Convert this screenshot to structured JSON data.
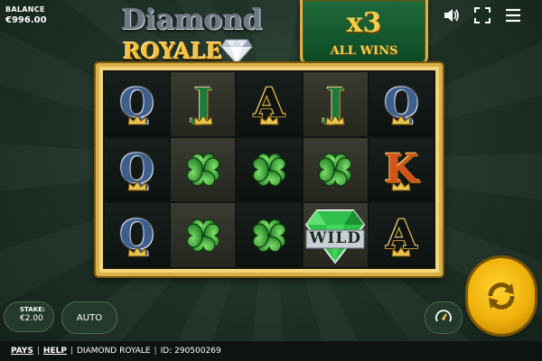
{
  "balance": {
    "label": "BALANCE",
    "value": "€996.00"
  },
  "logo": {
    "line1": "Diamond",
    "line2": "ROYALE"
  },
  "banner": {
    "multiplier": "x3",
    "text": "ALL WINS"
  },
  "icons": {
    "sound": "speaker-icon",
    "fullscreen": "fullscreen-icon",
    "menu": "hamburger-menu-icon"
  },
  "reels": {
    "rows": [
      [
        "Q",
        "J",
        "A",
        "J",
        "Q"
      ],
      [
        "Q",
        "clover",
        "clover",
        "clover",
        "K"
      ],
      [
        "Q",
        "clover",
        "clover",
        "WILD",
        "A"
      ]
    ]
  },
  "controls": {
    "stake_label": "STAKE:",
    "stake_value": "€2.00",
    "auto_label": "AUTO",
    "turbo_icon": "turbo-gauge-icon",
    "spin_icon": "spin-arrows-icon"
  },
  "footer": {
    "pays": "PAYS",
    "help": "HELP",
    "game_name": "DIAMOND ROYALE",
    "id": "ID: 290500269"
  },
  "colors": {
    "gold": "#d9b04a",
    "felt_green": "#1f3328",
    "spin_yellow": "#f0b00a"
  }
}
